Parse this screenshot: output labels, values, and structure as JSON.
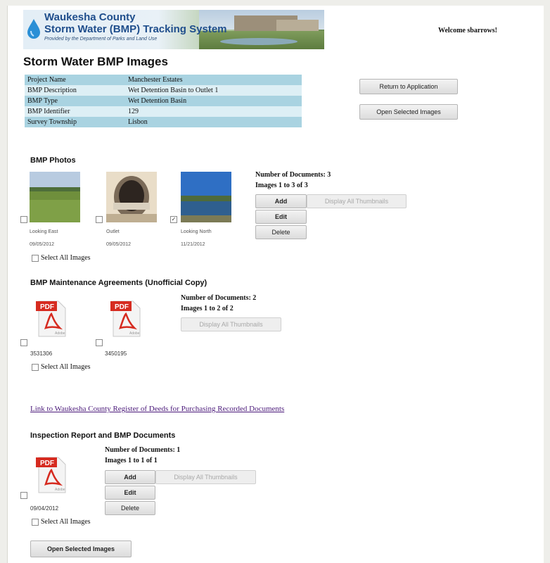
{
  "banner": {
    "line1": "Waukesha County",
    "line2": "Storm Water (BMP) Tracking System",
    "line3": "Provided by the Department of Parks and Land Use"
  },
  "welcome": "Welcome sbarrows!",
  "title": "Storm Water BMP Images",
  "info_rows": [
    {
      "label": "Project Name",
      "value": "Manchester Estates"
    },
    {
      "label": "BMP Description",
      "value": "Wet Detention Basin to Outlet 1"
    },
    {
      "label": "BMP Type",
      "value": "Wet Detention Basin"
    },
    {
      "label": "BMP Identifier",
      "value": "129"
    },
    {
      "label": "Survey Township",
      "value": "Lisbon"
    }
  ],
  "top_buttons": {
    "return": "Return to Application",
    "open": "Open Selected Images"
  },
  "photos": {
    "heading": "BMP Photos",
    "count": "Number of Documents: 3",
    "range": "Images 1 to 3 of 3",
    "buttons": {
      "add": "Add",
      "edit": "Edit",
      "delete": "Delete",
      "display": "Display All Thumbnails"
    },
    "items": [
      {
        "caption": "Looking East",
        "date": "09/05/2012"
      },
      {
        "caption": "Outlet",
        "date": "09/05/2012"
      },
      {
        "caption": "Looking North",
        "date": "11/21/2012"
      }
    ],
    "select_all": "Select All Images"
  },
  "agreements": {
    "heading": "BMP Maintenance Agreements (Unofficial Copy)",
    "count": "Number of Documents: 2",
    "range": "Images 1 to 2 of 2",
    "display": "Display All Thumbnails",
    "items": [
      {
        "number": "3531306"
      },
      {
        "number": "3450195"
      }
    ],
    "select_all": "Select All Images"
  },
  "register_link": "Link to Waukesha County Register of Deeds for Purchasing Recorded Documents",
  "inspection": {
    "heading": "Inspection Report and BMP Documents",
    "count": "Number of Documents: 1",
    "range": "Images 1 to 1 of 1",
    "buttons": {
      "add": "Add",
      "edit": "Edit",
      "delete": "Delete",
      "display": "Display All Thumbnails"
    },
    "items": [
      {
        "date": "09/04/2012"
      }
    ],
    "select_all": "Select All Images"
  },
  "bottom_button": "Open Selected Images",
  "pdf_label": "PDF",
  "pdf_sub": "Adobe"
}
